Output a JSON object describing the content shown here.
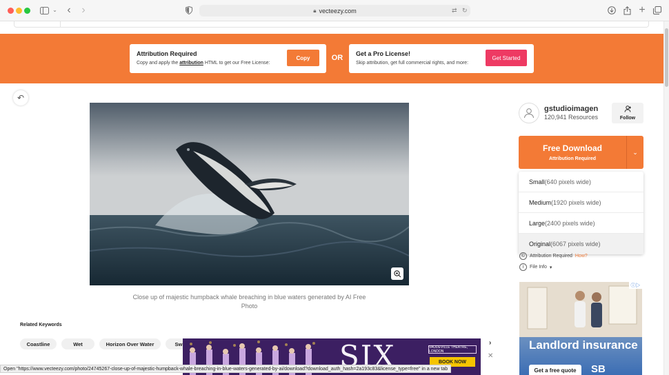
{
  "browser": {
    "url": "vecteezy.com",
    "colors": {
      "close": "#ff5f57",
      "minimize": "#febc2e",
      "zoom": "#28c840"
    },
    "icons": [
      "sidebar-icon",
      "chevron-down-icon",
      "back-icon",
      "forward-icon",
      "shield-icon",
      "lock-icon",
      "translate-icon",
      "reload-icon",
      "download-icon",
      "share-icon",
      "new-tab-icon",
      "tabs-icon"
    ]
  },
  "banner": {
    "color": "#f37a36",
    "attribution": {
      "title": "Attribution Required",
      "sub_before": "Copy and apply the",
      "sub_link": "attribution",
      "sub_after": "HTML to get our Free License:",
      "button": "Copy",
      "button_color": "#f37a36"
    },
    "or": "OR",
    "pro": {
      "title": "Get a Pro License!",
      "sub": "Skip attribution, get full commercial rights, and more:",
      "button": "Get Started",
      "button_color": "#ee3a63"
    }
  },
  "photo": {
    "caption": "Close up of majestic humpback whale breaching in blue waters generated by AI Free Photo"
  },
  "related": {
    "title": "Related Keywords",
    "keywords": [
      "Coastline",
      "Wet",
      "Horizon Over Water",
      "Swi"
    ]
  },
  "ad_banner": {
    "title": "SIX",
    "venue": "VAUDEVILLE THEATRE, LONDON",
    "cta": "BOOK NOW"
  },
  "status_bar": {
    "text": "Open \"https://www.vecteezy.com/photo/24745267-close-up-of-majestic-humpback-whale-breaching-in-blue-waters-generated-by-ai/download?download_auth_hash=2a193c83&license_type=free\" in a new tab"
  },
  "author": {
    "name": "gstudioimagen",
    "resources": "120,941 Resources",
    "follow": "Follow"
  },
  "download": {
    "label": "Free Download",
    "sub": "Attribution Required",
    "color": "#f37a36",
    "options": [
      {
        "size": "Small",
        "detail": "(640 pixels wide)"
      },
      {
        "size": "Medium",
        "detail": "(1920 pixels wide)"
      },
      {
        "size": "Large",
        "detail": "(2400 pixels wide)"
      },
      {
        "size": "Original",
        "detail": "(6067 pixels wide)"
      }
    ]
  },
  "meta": {
    "attribution": "Attribution Required",
    "how": "How?",
    "file_info": "File Info"
  },
  "side_ad": {
    "headline": "Landlord insurance",
    "cta": "Get a free quote",
    "brand": "SB"
  }
}
